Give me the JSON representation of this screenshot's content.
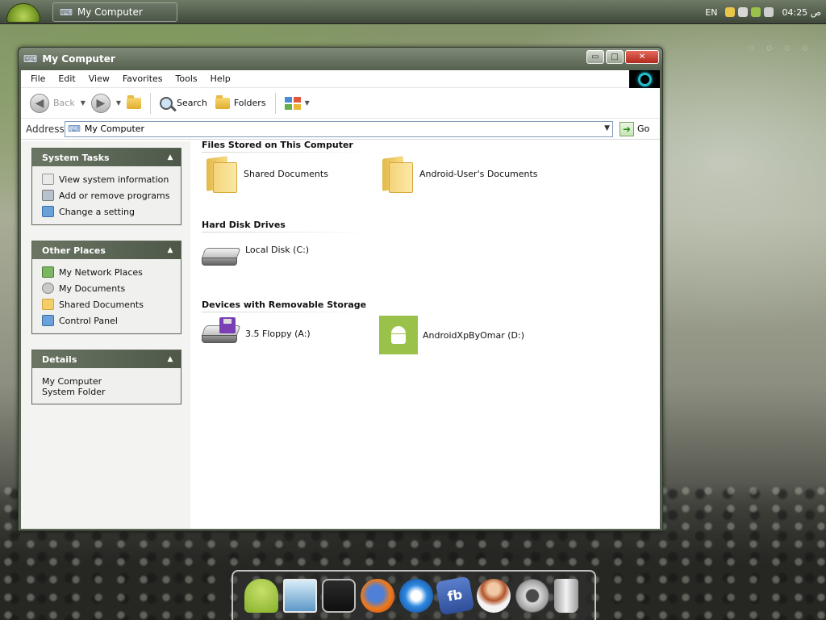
{
  "taskbar": {
    "task_button": "My Computer",
    "language": "EN",
    "ampm": "ص",
    "time": "04:25"
  },
  "window": {
    "title": "My Computer",
    "controls": {
      "minimize": "▭",
      "maximize": "□",
      "close": "✕"
    }
  },
  "menu": [
    "File",
    "Edit",
    "View",
    "Favorites",
    "Tools",
    "Help"
  ],
  "toolbar": {
    "back": "Back",
    "search": "Search",
    "folders": "Folders"
  },
  "address": {
    "label": "Address",
    "value": "My Computer",
    "go": "Go"
  },
  "system_tasks": {
    "title": "System Tasks",
    "items": [
      "View system information",
      "Add or remove programs",
      "Change a setting"
    ]
  },
  "other_places": {
    "title": "Other Places",
    "items": [
      "My Network Places",
      "My Documents",
      "Shared Documents",
      "Control Panel"
    ]
  },
  "details": {
    "title": "Details",
    "name": "My Computer",
    "type": "System Folder"
  },
  "groups": {
    "files": {
      "title": "Files Stored on This Computer",
      "items": [
        "Shared Documents",
        "Android-User's Documents"
      ]
    },
    "hdd": {
      "title": "Hard Disk Drives",
      "items": [
        "Local Disk (C:)"
      ]
    },
    "removable": {
      "title": "Devices with Removable Storage",
      "items": [
        "3.5 Floppy (A:)",
        "AndroidXpByOmar (D:)"
      ]
    }
  },
  "dock": {
    "fb_text": "fb"
  },
  "colors": {
    "accent_green": "#9ac14a",
    "window_frame": "#5a6553",
    "go_arrow": "#2e8a1c"
  }
}
